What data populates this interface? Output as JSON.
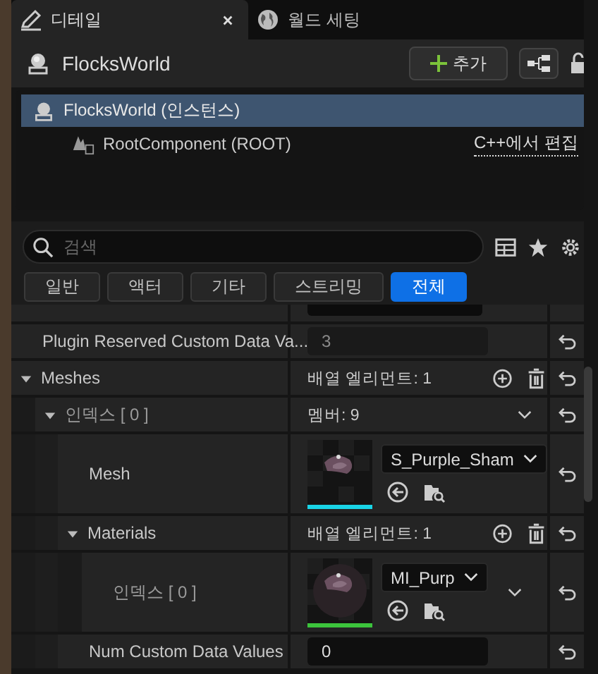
{
  "tabs": [
    {
      "label": "디테일",
      "selected": true,
      "kind": "details"
    },
    {
      "label": "월드 세팅",
      "selected": false,
      "kind": "world"
    }
  ],
  "header": {
    "title": "FlocksWorld",
    "add_button": "추가"
  },
  "components": [
    {
      "label": "FlocksWorld (인스턴스)",
      "selected": true,
      "kind": "actor",
      "children": [
        {
          "label": "RootComponent (ROOT)",
          "selected": false,
          "kind": "scene",
          "link": "C++에서 편집"
        }
      ]
    }
  ],
  "search": {
    "placeholder": "검색"
  },
  "filters": [
    {
      "label": "일반",
      "selected": false
    },
    {
      "label": "액터",
      "selected": false
    },
    {
      "label": "기타",
      "selected": false
    },
    {
      "label": "스트리밍",
      "selected": false
    },
    {
      "label": "전체",
      "selected": true
    }
  ],
  "properties": [
    {
      "name": "Plugin Reserved Custom Data Va...",
      "kind": "number",
      "value": "3",
      "disabled": true
    },
    {
      "name": "Meshes",
      "kind": "array",
      "value": "배열 엘리먼트: 1",
      "expanded": true,
      "children": [
        {
          "name": "인덱스 [ 0 ]",
          "kind": "struct",
          "value": "멤버: 9",
          "expanded": true,
          "children": [
            {
              "name": "Mesh",
              "kind": "asset",
              "value": "S_Purple_Sham",
              "color": "#19d4e6"
            },
            {
              "name": "Materials",
              "kind": "array",
              "value": "배열 엘리먼트: 1",
              "expanded": true,
              "children": [
                {
                  "name": "인덱스 [ 0 ]",
                  "kind": "asset",
                  "value": "MI_Purp",
                  "color": "#3cc43c",
                  "expandable": true
                }
              ]
            },
            {
              "name": "Num Custom Data Values",
              "kind": "number",
              "value": "0",
              "disabled": false
            }
          ]
        }
      ]
    }
  ]
}
